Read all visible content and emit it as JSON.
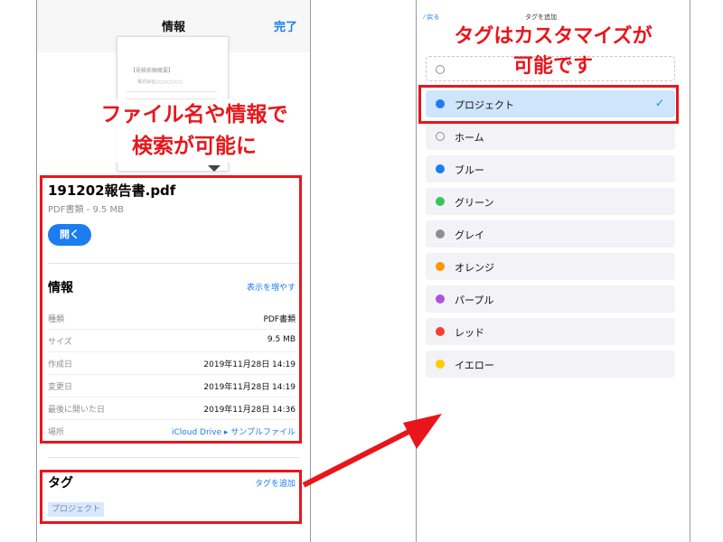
{
  "left": {
    "nav": {
      "title": "情報",
      "done": "完了"
    },
    "thumbnail": {
      "title": "【見積依頼概要】",
      "subtitle": "株式会社○○○○○○○"
    },
    "callout": [
      "ファイル名や情報で",
      "検索が可能に"
    ],
    "file": {
      "name": "191202報告書.pdf",
      "meta": "PDF書類 - 9.5 MB",
      "open": "開く"
    },
    "info": {
      "heading": "情報",
      "more": "表示を増やす",
      "rows": [
        {
          "key": "種類",
          "value": "PDF書類"
        },
        {
          "key": "サイズ",
          "value": "9.5 MB"
        },
        {
          "key": "作成日",
          "value": "2019年11月28日 14:19"
        },
        {
          "key": "変更日",
          "value": "2019年11月28日 14:19"
        },
        {
          "key": "最後に開いた日",
          "value": "2019年11月28日 14:36"
        },
        {
          "key": "場所",
          "value": "iCloud Drive ▸ サンプルファイル"
        }
      ]
    },
    "tags": {
      "heading": "タグ",
      "add": "タグを追加",
      "chip": "プロジェクト"
    }
  },
  "right": {
    "nav_fragment_left": "⁄ 戻る",
    "nav_fragment_center": "タグを追加",
    "callout": [
      "タグはカスタマイズが",
      "可能です"
    ],
    "tags": [
      {
        "label": "プロジェクト",
        "color": "#1b7df0",
        "selected": true
      },
      {
        "label": "ホーム",
        "color": "hollow",
        "selected": false
      },
      {
        "label": "ブルー",
        "color": "#1b7df0",
        "selected": false
      },
      {
        "label": "グリーン",
        "color": "#34c759",
        "selected": false
      },
      {
        "label": "グレイ",
        "color": "#8e8e93",
        "selected": false
      },
      {
        "label": "オレンジ",
        "color": "#ff9500",
        "selected": false
      },
      {
        "label": "パープル",
        "color": "#af52de",
        "selected": false
      },
      {
        "label": "レッド",
        "color": "#ff3b30",
        "selected": false
      },
      {
        "label": "イエロー",
        "color": "#ffcc00",
        "selected": false
      }
    ],
    "check_icon": "✓"
  },
  "colors": {
    "accent": "#1b7df0",
    "highlight": "#e8161b"
  }
}
